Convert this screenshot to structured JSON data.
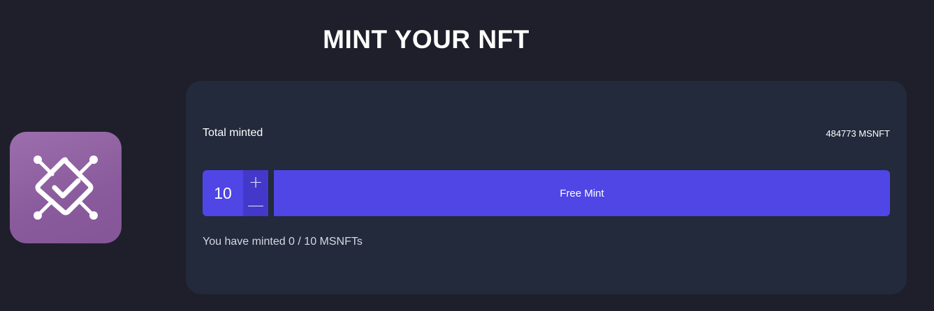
{
  "header": {
    "title": "MINT YOUR NFT"
  },
  "logo": {
    "icon": "nft-diamond-check-icon",
    "colors": {
      "tile_top": "#9c6eac",
      "tile_bottom": "#845597"
    }
  },
  "card": {
    "total_minted_label": "Total minted",
    "total_minted_value": "484773 MSNFT",
    "quantity": "10",
    "increment_symbol": "+",
    "decrement_symbol": "—",
    "mint_button_label": "Free Mint",
    "user_minted_text": "You have minted 0 / 10 MSNFTs"
  },
  "colors": {
    "background": "#1e1f2a",
    "card": "#222a3c",
    "accent": "#4f46e5",
    "accent_dark": "#4338ca"
  }
}
